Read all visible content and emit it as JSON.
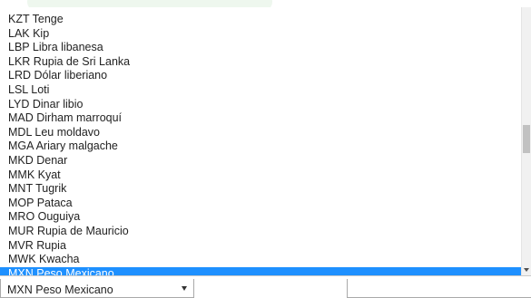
{
  "currency_dropdown": {
    "options": [
      "KZT Tenge",
      "LAK Kip",
      "LBP Libra libanesa",
      "LKR Rupia de Sri Lanka",
      "LRD Dólar liberiano",
      "LSL Loti",
      "LYD Dinar libio",
      "MAD Dirham marroquí",
      "MDL Leu moldavo",
      "MGA Ariary malgache",
      "MKD Denar",
      "MMK Kyat",
      "MNT Tugrik",
      "MOP Pataca",
      "MRO Ouguiya",
      "MUR Rupia de Mauricio",
      "MVR Rupia",
      "MWK Kwacha",
      "MXN Peso Mexicano"
    ],
    "selected_index": 18,
    "selected_label": "MXN Peso Mexicano",
    "highlight_color": "#1e90ff"
  },
  "amount_input": {
    "value": ""
  },
  "icons": {
    "select_arrow": "caret-down-icon",
    "scroll_down": "scroll-down-arrow-icon"
  }
}
